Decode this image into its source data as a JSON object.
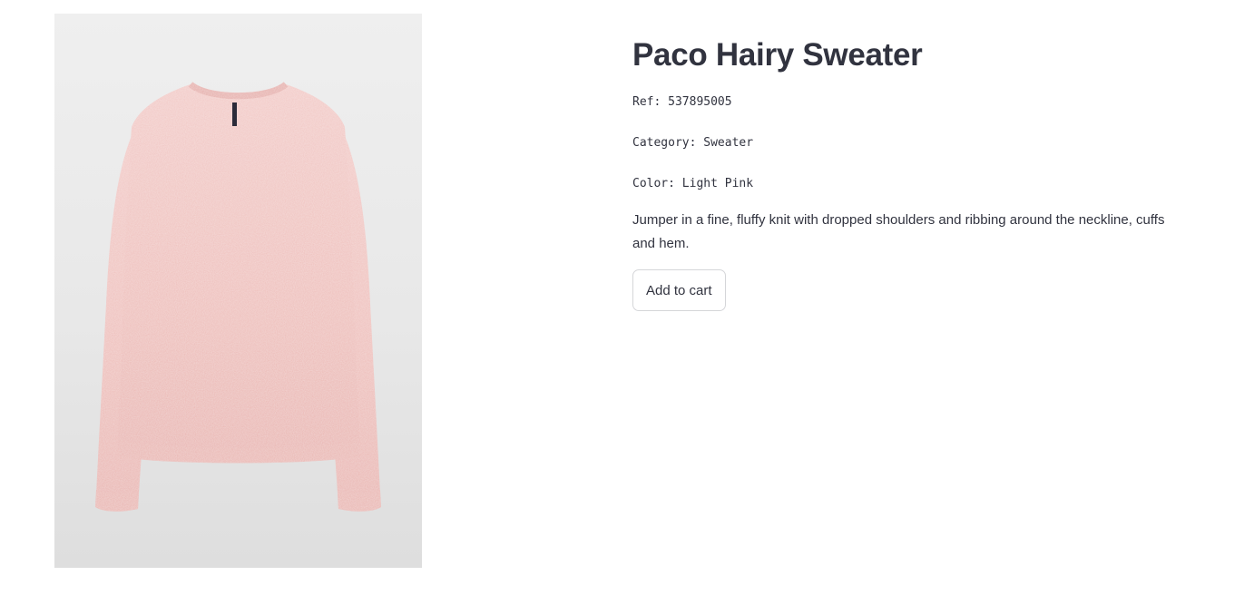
{
  "product": {
    "title": "Paco Hairy Sweater",
    "ref": "Ref: 537895005",
    "category": "Category: Sweater",
    "color": "Color: Light Pink",
    "description": "Jumper in a fine, fluffy knit with dropped shoulders and ribbing around the neckline, cuffs and hem.",
    "image_alt": "Paco Hairy Sweater",
    "garment_color": "#f1c3c1"
  },
  "actions": {
    "add_to_cart_label": "Add to cart"
  }
}
